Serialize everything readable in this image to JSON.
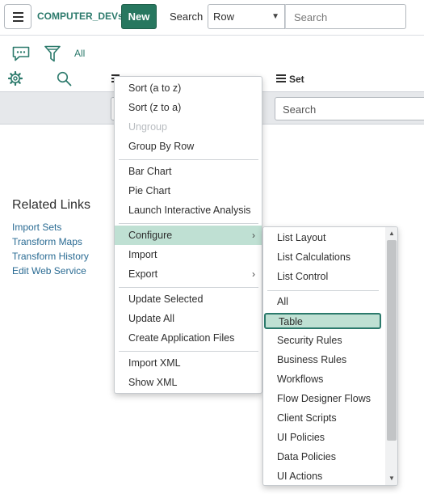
{
  "header": {
    "table_name": "COMPUTER_DEVs",
    "new_label": "New",
    "search_label": "Search",
    "field_value": "Row",
    "search_placeholder": "Search"
  },
  "toolbar": {
    "all_label": "All",
    "set_label": "Set"
  },
  "filter_strip": {
    "search_placeholder": "Search"
  },
  "related_links": {
    "title": "Related Links",
    "items": [
      "Import Sets",
      "Transform Maps",
      "Transform History",
      "Edit Web Service"
    ]
  },
  "context_menu": {
    "items": [
      {
        "label": "Sort (a to z)"
      },
      {
        "label": "Sort (z to a)"
      },
      {
        "label": "Ungroup",
        "disabled": true
      },
      {
        "label": "Group By Row"
      },
      {
        "label": "Bar Chart"
      },
      {
        "label": "Pie Chart"
      },
      {
        "label": "Launch Interactive Analysis"
      },
      {
        "label": "Configure",
        "has_submenu": true,
        "active": true
      },
      {
        "label": "Import"
      },
      {
        "label": "Export",
        "has_submenu": true
      },
      {
        "label": "Update Selected"
      },
      {
        "label": "Update All"
      },
      {
        "label": "Create Application Files"
      },
      {
        "label": "Import XML"
      },
      {
        "label": "Show XML"
      }
    ]
  },
  "configure_submenu": {
    "items": [
      {
        "label": "List Layout"
      },
      {
        "label": "List Calculations"
      },
      {
        "label": "List Control"
      },
      {
        "label": "All"
      },
      {
        "label": "Table",
        "highlighted": true
      },
      {
        "label": "Security Rules"
      },
      {
        "label": "Business Rules"
      },
      {
        "label": "Workflows"
      },
      {
        "label": "Flow Designer Flows"
      },
      {
        "label": "Client Scripts"
      },
      {
        "label": "UI Policies"
      },
      {
        "label": "Data Policies"
      },
      {
        "label": "UI Actions"
      }
    ]
  },
  "colors": {
    "brand_green": "#27775f",
    "link_teal": "#2c7a6c",
    "highlight": "#bfe0d3",
    "link_blue": "#2a6b93"
  },
  "icons": [
    "hamburger-icon",
    "chat-icon",
    "funnel-icon",
    "gear-icon",
    "magnifier-icon",
    "list-icon",
    "chevron-right-icon",
    "caret-down-icon",
    "scroll-up-icon",
    "scroll-down-icon"
  ]
}
